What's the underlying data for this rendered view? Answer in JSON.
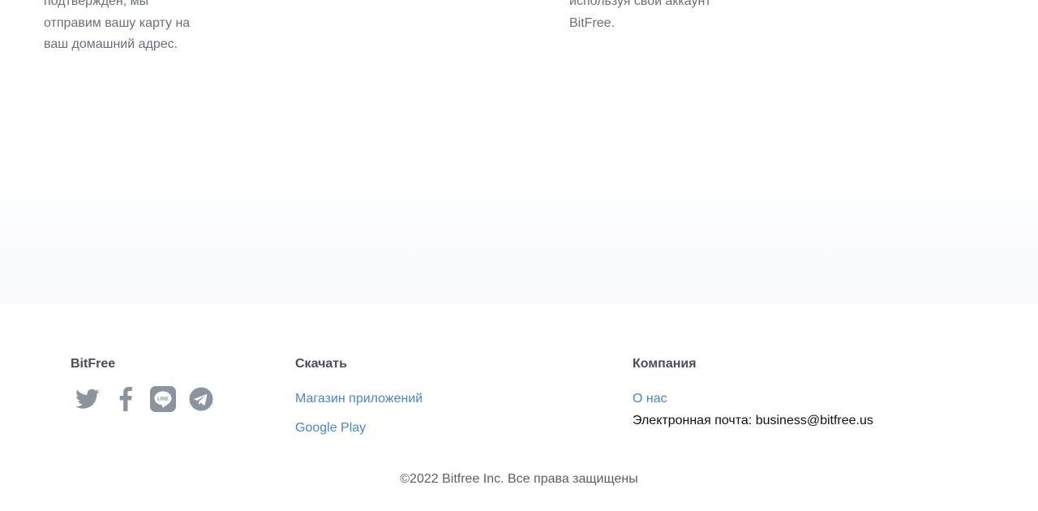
{
  "steps": {
    "left_lines": [
      "подтвержден, мы",
      "отправим вашу карту на",
      "ваш домашний адрес."
    ],
    "right_lines": [
      "используя свой аккаунт",
      "BitFree."
    ]
  },
  "footer": {
    "brand": {
      "title": "BitFree",
      "social": [
        "twitter-icon",
        "facebook-icon",
        "line-icon",
        "telegram-icon"
      ],
      "icon_color": "#8b939e"
    },
    "download": {
      "title": "Скачать",
      "links": [
        "Магазин приложений",
        "Google Play"
      ]
    },
    "company": {
      "title": "Компания",
      "about_label": "О нас",
      "email_label": "Электронная почта:",
      "email_value": "business@bitfree.us"
    },
    "copyright": "©2022 Bitfree Inc. Все права защищены"
  },
  "colors": {
    "link": "#4a84d4",
    "heading": "#4a4e58",
    "body_text": "#6b6f7a"
  }
}
